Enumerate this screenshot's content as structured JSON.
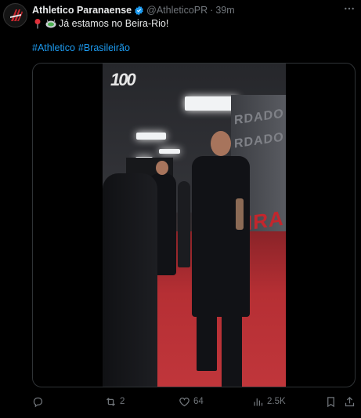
{
  "post": {
    "author_name": "Athletico Paranaense",
    "handle": "@AthleticoPR",
    "separator": "·",
    "time": "39m",
    "text": "Já estamos no Beira-Rio!",
    "hashtags": [
      "#Athletico",
      "#Brasileirão"
    ],
    "media": {
      "type": "video",
      "overlay_logo": "100"
    }
  },
  "actions": {
    "reply_count": "",
    "retweet_count": "2",
    "like_count": "64",
    "views_count": "2.5K"
  },
  "colors": {
    "background": "#000000",
    "text": "#e7e9ea",
    "muted": "#71767b",
    "link": "#1d9bf0",
    "verified": "#1d9bf0",
    "brand_red": "#c3262d"
  }
}
